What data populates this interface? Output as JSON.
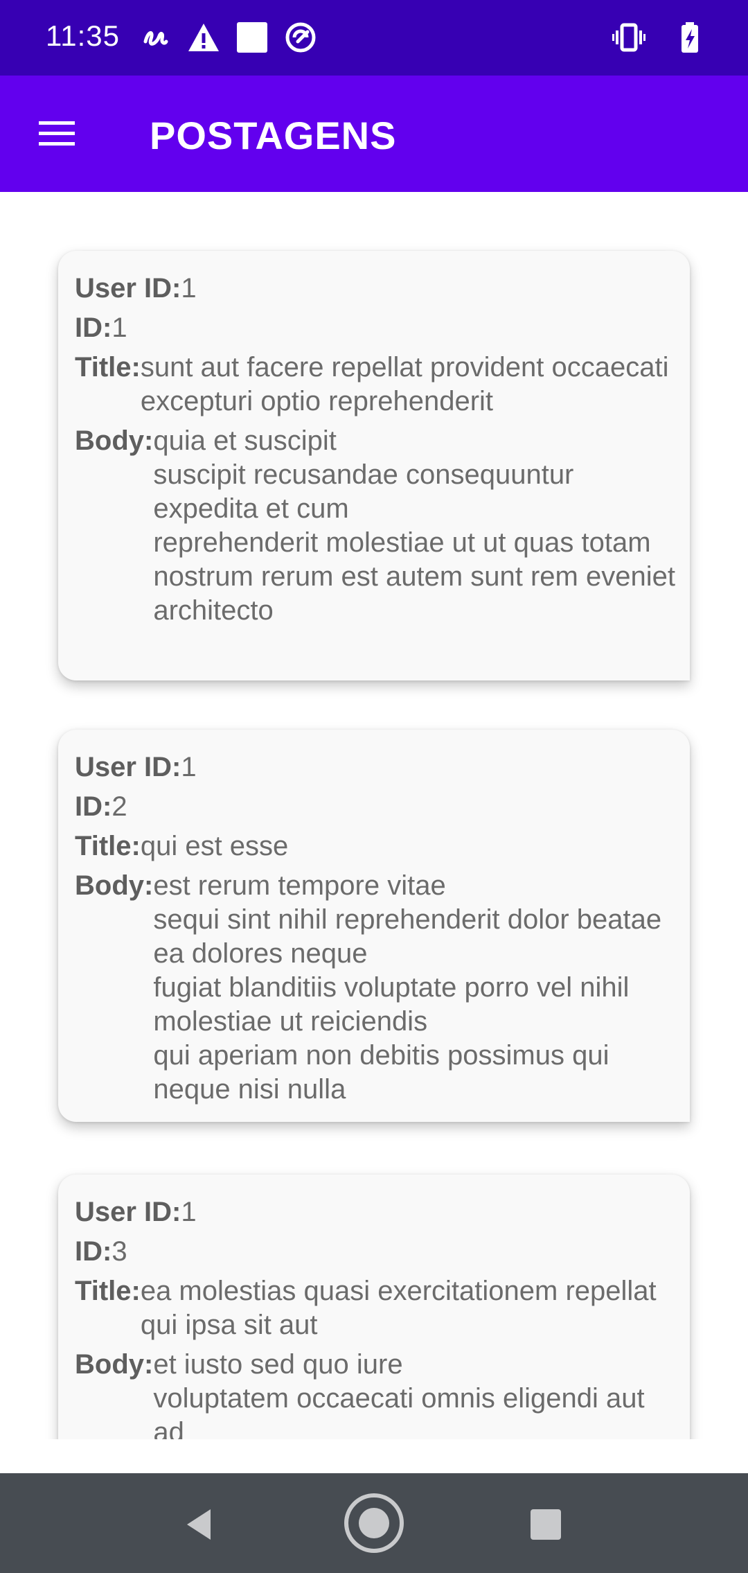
{
  "status_bar": {
    "time": "11:35",
    "left_icons": [
      "scribble-icon",
      "warning-icon",
      "square-notification-icon",
      "circle-notification-icon"
    ],
    "right_icons": [
      "vibrate-icon",
      "battery-charging-icon"
    ],
    "background": "#3700b3"
  },
  "app_bar": {
    "title": "POSTAGENS",
    "background": "#6200ee"
  },
  "labels": {
    "user_id": "User ID:",
    "id": "ID:",
    "title": "Title:",
    "body": "Body:"
  },
  "posts": [
    {
      "user_id": "1",
      "id": "1",
      "title": "sunt aut facere repellat provident occaecati excepturi optio reprehenderit",
      "body": "quia et suscipit\nsuscipit recusandae consequuntur expedita et cum\nreprehenderit molestiae ut ut quas totam\nnostrum rerum est autem sunt rem eveniet architecto"
    },
    {
      "user_id": "1",
      "id": "2",
      "title": "qui est esse",
      "body": "est rerum tempore vitae\nsequi sint nihil reprehenderit dolor beatae ea dolores neque\nfugiat blanditiis voluptate porro vel nihil molestiae ut reiciendis\nqui aperiam non debitis possimus qui neque nisi nulla"
    },
    {
      "user_id": "1",
      "id": "3",
      "title": "ea molestias quasi exercitationem repellat qui ipsa sit aut",
      "body": "et iusto sed quo iure\nvoluptatem occaecati omnis eligendi aut ad"
    }
  ],
  "nav_bar": {
    "buttons": [
      "back-icon",
      "home-icon",
      "recents-icon"
    ],
    "background": "#474c52"
  }
}
